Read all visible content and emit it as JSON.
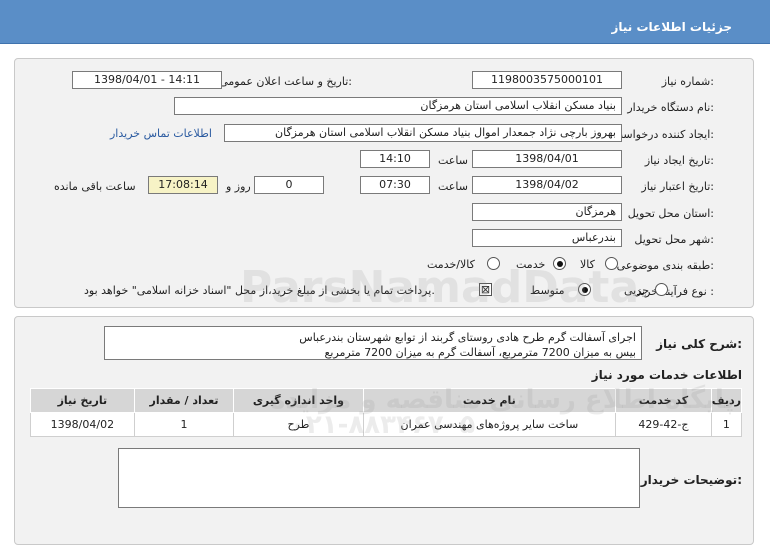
{
  "header": {
    "title": "جزئیات اطلاعات نیاز"
  },
  "form": {
    "need_number_label": "شماره نیاز:",
    "need_number": "1198003575000101",
    "announce_label": "تاریخ و ساعت اعلان عمومی:",
    "announce_value": "1398/04/01 - 14:11",
    "buyer_org_label": "نام دستگاه خریدار:",
    "buyer_org": "بنیاد مسکن انقلاب اسلامی استان هرمزگان",
    "requester_label": "ایجاد کننده درخواست:",
    "requester": "بهروز  بارچی نژاد جمعدار اموال بنیاد مسکن انقلاب اسلامی استان هرمزگان",
    "contact_link": "اطلاعات تماس خریدار",
    "created_label": "تاریخ ایجاد نیاز:",
    "created_date": "1398/04/01",
    "time_label": "ساعت",
    "created_time": "14:10",
    "validity_label": "تاریخ اعتبار نیاز:",
    "validity_date": "1398/04/02",
    "validity_time": "07:30",
    "days_value": "0",
    "days_label": "روز و",
    "remaining_time": "17:08:14",
    "remaining_label": "ساعت باقی مانده",
    "province_label": "استان محل تحویل:",
    "province": "هرمزگان",
    "city_label": "شهر محل تحویل:",
    "city": "بندرعباس",
    "category_label": "طبقه بندی موضوعی:",
    "category_options": [
      "کالا",
      "خدمت",
      "کالا/خدمت"
    ],
    "process_label": "نوع فرآیند خرید :",
    "process_options": [
      "جزیی",
      "متوسط"
    ],
    "payment_note": "پرداخت تمام یا بخشی از مبلغ خرید،از محل \"اسناد خزانه اسلامی\" خواهد بود."
  },
  "description": {
    "label": "شرح کلی نیاز:",
    "line1": "اجرای آسفالت گرم طرح هادی روستای گربند از توابع شهرستان بندرعباس",
    "line2": "بیس به میزان 7200 مترمربع، آسفالت گرم به میزان 7200 مترمربع"
  },
  "services": {
    "title": "اطلاعات خدمات مورد نیاز",
    "headers": [
      "ردیف",
      "کد خدمت",
      "نام خدمت",
      "واحد اندازه گیری",
      "تعداد / مقدار",
      "تاریخ نیاز"
    ],
    "rows": [
      [
        "1",
        "ج-42-429",
        "ساخت سایر پروژه‌های مهندسی عمران",
        "طرح",
        "1",
        "1398/04/02"
      ]
    ]
  },
  "buyer_notes": {
    "label": "توضیحات خریدار:"
  },
  "watermark": {
    "text1": "ParsNamadData",
    "text2": "پایگاه اطلاع رسانی مناقصه و مزایده",
    "text3": "۰۲۱-۸۸۳۴۶۷۰۵"
  },
  "colors": {
    "header_bg": "#5a8ec7",
    "panel_bg": "#f2f2f2",
    "remaining_bg": "#f7f3c6",
    "link": "#2a5aa0"
  }
}
